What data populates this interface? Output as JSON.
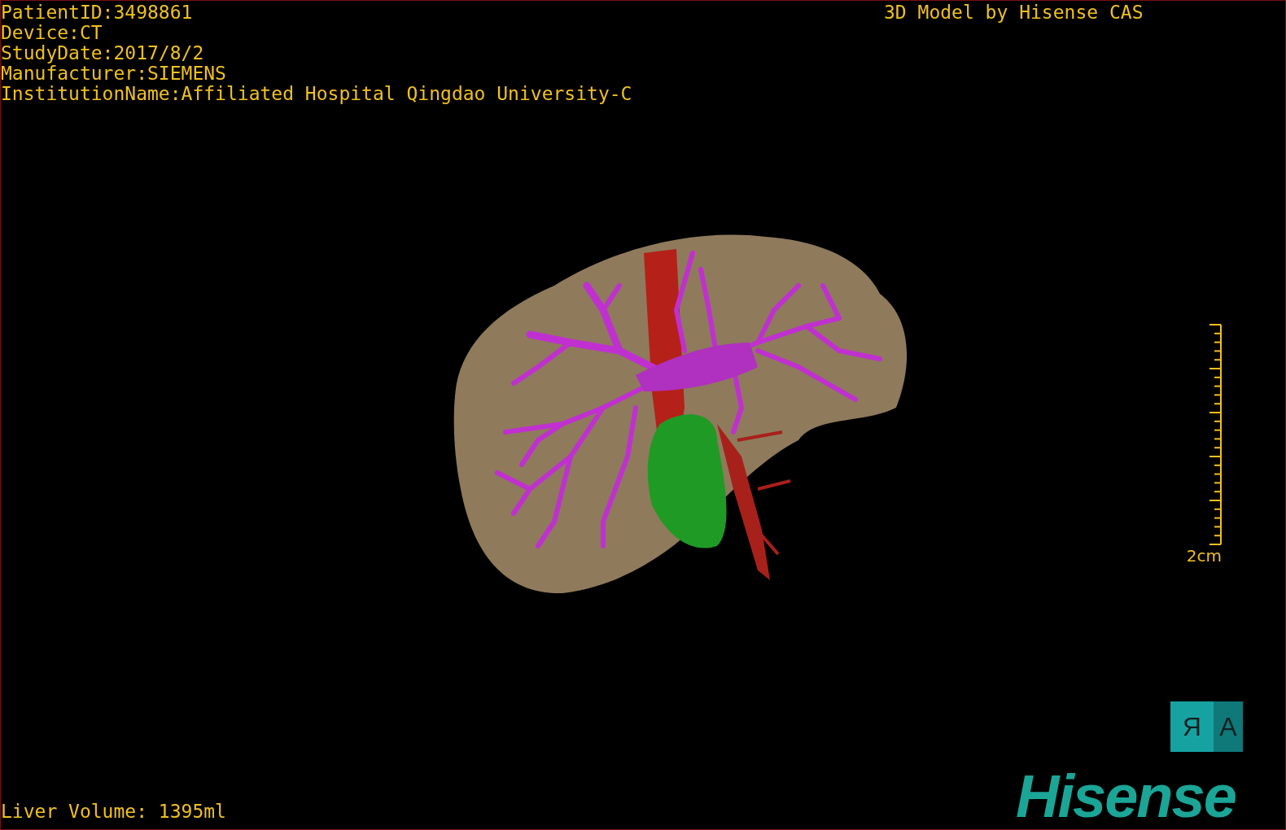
{
  "patient_info": [
    "PatientID:3498861",
    "Device:CT",
    "StudyDate:2017/8/2",
    "Manufacturer:SIEMENS",
    "InstitutionName:Affiliated Hospital Qingdao University-C"
  ],
  "title": "3D Model by Hisense CAS",
  "scale_bar": {
    "label": "2cm"
  },
  "orientation_cube": {
    "faces": [
      "R",
      "A"
    ]
  },
  "liver_volume": "Liver Volume: 1395ml",
  "logo": "Hisense"
}
